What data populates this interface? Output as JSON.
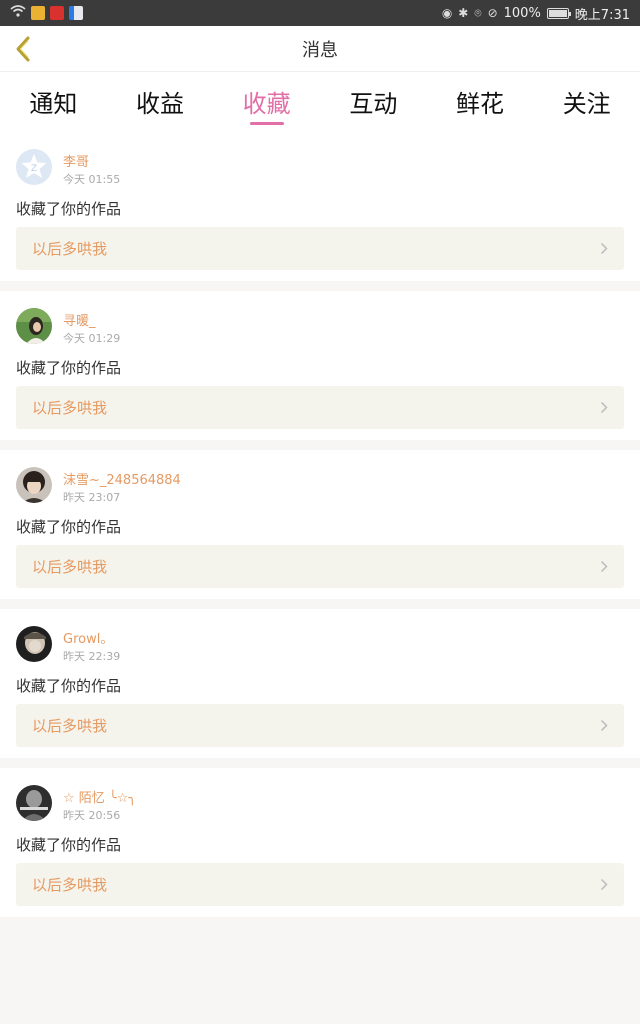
{
  "status_bar": {
    "battery": "100%",
    "time": "晚上7:31",
    "left_icons": [
      "wifi-icon",
      "app-icon-yellow",
      "app-icon-red",
      "app-icon-blue"
    ],
    "right_icons": [
      "eye-icon",
      "bluetooth-icon",
      "location-icon",
      "mute-icon",
      "battery-icon"
    ]
  },
  "header": {
    "title": "消息",
    "back_icon": "back-arrow-icon"
  },
  "tabs": [
    {
      "label": "通知"
    },
    {
      "label": "收益"
    },
    {
      "label": "收藏",
      "active": true
    },
    {
      "label": "互动"
    },
    {
      "label": "鲜花"
    },
    {
      "label": "关注"
    }
  ],
  "items": [
    {
      "username": "李哥",
      "time": "今天 01:55",
      "message": "收藏了你的作品",
      "work_title": "以后多哄我"
    },
    {
      "username": "寻暖_",
      "time": "今天 01:29",
      "message": "收藏了你的作品",
      "work_title": "以后多哄我"
    },
    {
      "username": "沫雪~_248564884",
      "time": "昨天 23:07",
      "message": "收藏了你的作品",
      "work_title": "以后多哄我"
    },
    {
      "username": "Growl。",
      "time": "昨天 22:39",
      "message": "收藏了你的作品",
      "work_title": "以后多哄我"
    },
    {
      "username": "☆ 陌忆 ╰☆╮",
      "time": "昨天 20:56",
      "message": "收藏了你的作品",
      "work_title": "以后多哄我"
    }
  ],
  "colors": {
    "accent": "#e26fa7",
    "username": "#e59a62",
    "back_arrow": "#b9a033",
    "ref_box": "#f5f4ec"
  }
}
